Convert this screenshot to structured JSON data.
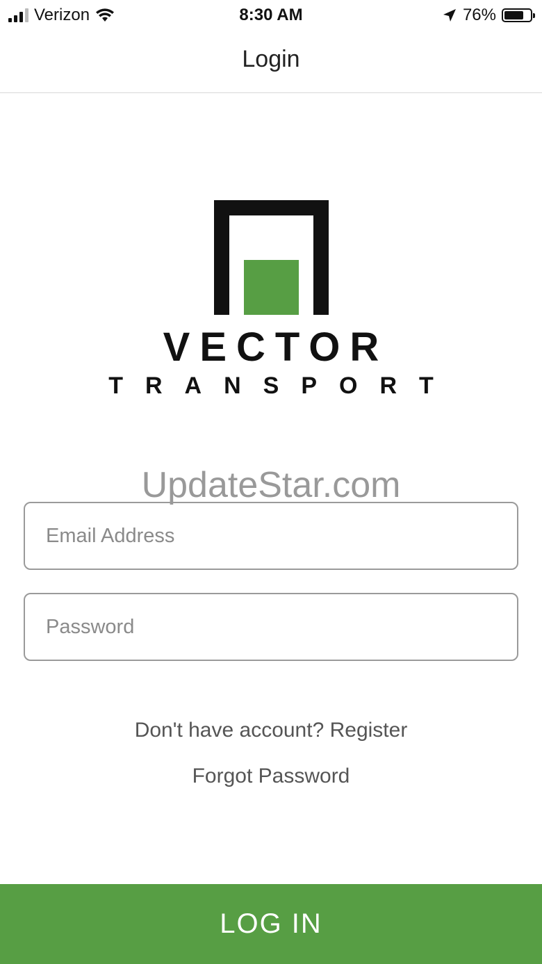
{
  "status_bar": {
    "carrier": "Verizon",
    "time": "8:30 AM",
    "battery_percent": "76%",
    "battery_level": 0.76
  },
  "nav": {
    "title": "Login"
  },
  "logo": {
    "line1": "VECTOR",
    "line2": "TRANSPORT",
    "accent_color": "#579e44"
  },
  "watermark": "UpdateStar.com",
  "form": {
    "email_placeholder": "Email Address",
    "password_placeholder": "Password"
  },
  "links": {
    "register": "Don't have account? Register",
    "forgot_password": "Forgot Password"
  },
  "login_button": {
    "label": "LOG IN",
    "color": "#579e44"
  }
}
